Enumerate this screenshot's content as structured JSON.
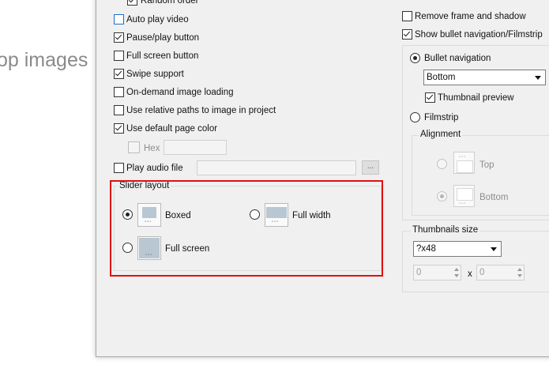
{
  "background": {
    "text": "op images"
  },
  "left_options": {
    "random_order": "Random order",
    "auto_play_video": "Auto play video",
    "pause_play_button": "Pause/play button",
    "full_screen_button": "Full screen button",
    "swipe_support": "Swipe support",
    "on_demand_loading": "On-demand image loading",
    "relative_paths": "Use relative paths to image in project",
    "default_page_color": "Use default page color",
    "hex_label": "Hex",
    "hex_value": "",
    "play_audio_file": "Play audio file",
    "audio_file_value": "",
    "browse_label": "..."
  },
  "slider_layout": {
    "title": "Slider layout",
    "boxed": "Boxed",
    "full_width": "Full width",
    "full_screen": "Full screen"
  },
  "right_options": {
    "remove_frame": "Remove frame and shadow",
    "show_nav": "Show bullet navigation/Filmstrip",
    "bullet_navigation": "Bullet navigation",
    "bullet_position": "Bottom",
    "thumbnail_preview": "Thumbnail preview",
    "filmstrip": "Filmstrip",
    "alignment_title": "Alignment",
    "align_top": "Top",
    "align_bottom": "Bottom",
    "thumb_size_title": "Thumbnails size",
    "thumb_size_value": "?x48",
    "width_value": "0",
    "height_value": "0",
    "times": "x"
  },
  "colors": {
    "highlight": "#e01010",
    "dialog_bg": "#f0f0f0"
  }
}
